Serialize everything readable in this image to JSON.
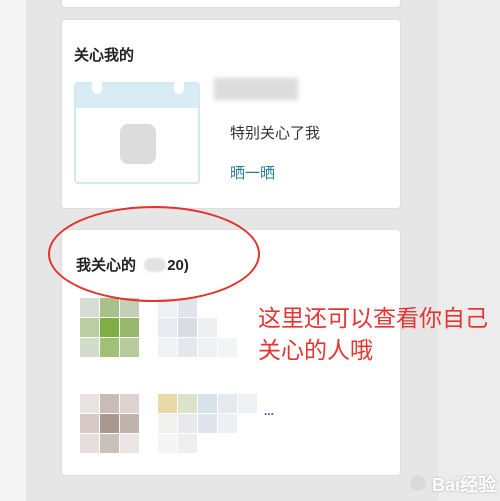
{
  "sections": {
    "cares_about_me": {
      "title": "关心我的",
      "description": "特别关心了我",
      "action_link": "晒一晒"
    },
    "i_care_about": {
      "title_prefix": "我关心的",
      "count_suffix": "20)"
    }
  },
  "annotation": {
    "text": "这里还可以查看你自己关心的人哦"
  },
  "more_indicator": "...",
  "watermark": "Bai经验",
  "colors": {
    "annotation_red": "#e53532",
    "link_teal": "#2a7e94"
  }
}
